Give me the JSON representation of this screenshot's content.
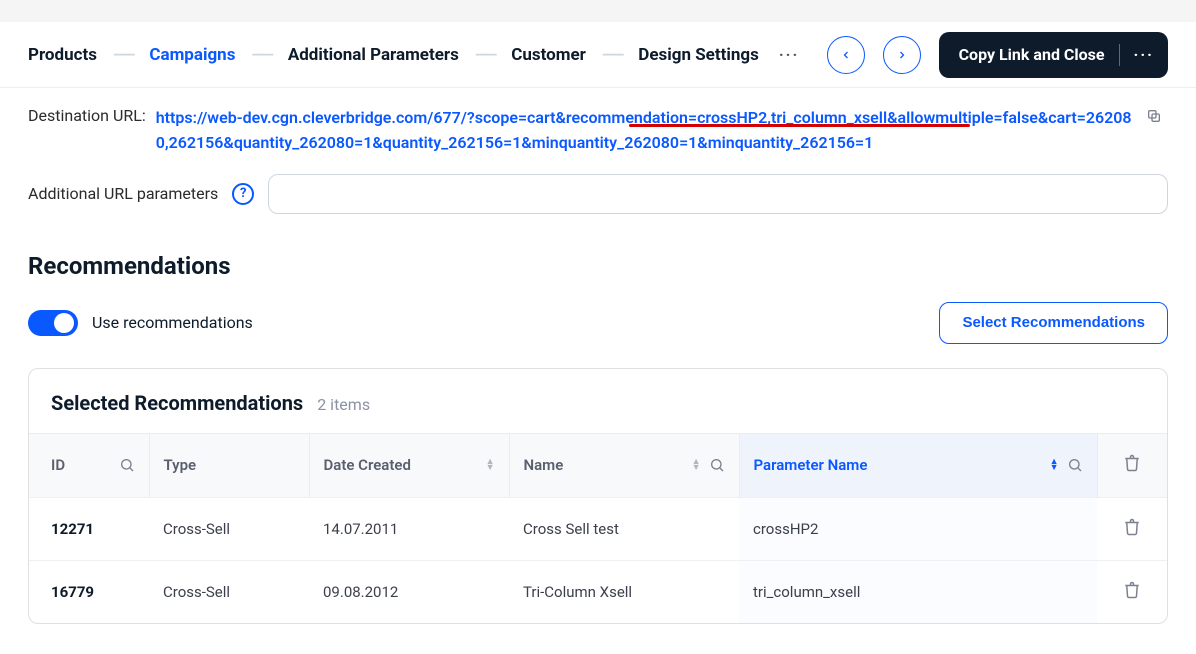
{
  "nav": {
    "tabs": [
      "Products",
      "Campaigns",
      "Additional Parameters",
      "Customer",
      "Design Settings"
    ],
    "active_index": 1,
    "copy_button": "Copy Link and Close"
  },
  "url": {
    "label": "Destination URL:",
    "value": "https://web-dev.cgn.cleverbridge.com/677/?scope=cart&recommendation=crossHP2,tri_column_xsell&allowmultiple=false&cart=262080,262156&quantity_262080=1&quantity_262156=1&minquantity_262080=1&minquantity_262156=1"
  },
  "params": {
    "label": "Additional URL parameters",
    "value": ""
  },
  "section": {
    "title": "Recommendations",
    "toggle_label": "Use recommendations",
    "toggle_on": true,
    "select_button": "Select Recommendations"
  },
  "table": {
    "title": "Selected Recommendations",
    "count_label": "2 items",
    "columns": {
      "id": "ID",
      "type": "Type",
      "date": "Date Created",
      "name": "Name",
      "param": "Parameter Name"
    },
    "rows": [
      {
        "id": "12271",
        "type": "Cross-Sell",
        "date": "14.07.2011",
        "name": "Cross Sell test",
        "param": "crossHP2"
      },
      {
        "id": "16779",
        "type": "Cross-Sell",
        "date": "09.08.2012",
        "name": "Tri-Column Xsell",
        "param": "tri_column_xsell"
      }
    ]
  }
}
